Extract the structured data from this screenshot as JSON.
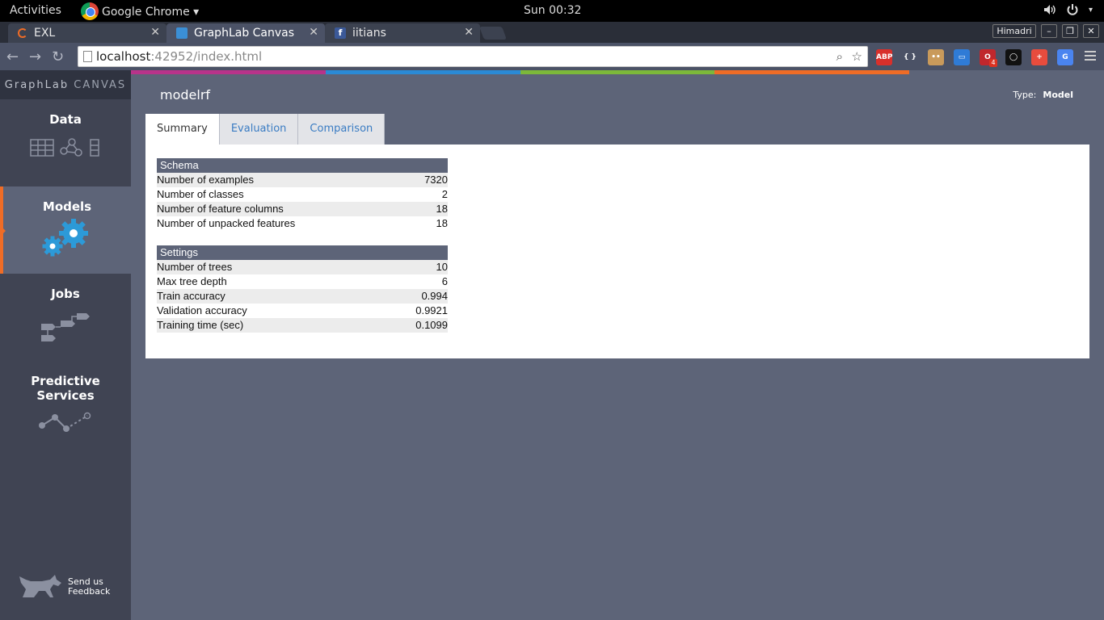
{
  "os": {
    "activities": "Activities",
    "app_name": "Google Chrome ▾",
    "clock": "Sun 00:32"
  },
  "browser": {
    "tabs": [
      {
        "title": "EXL"
      },
      {
        "title": "GraphLab Canvas"
      },
      {
        "title": "iitians"
      }
    ],
    "user": "Himadri",
    "url_host": "localhost",
    "url_path": ":42952/index.html",
    "extensions": [
      {
        "name": "adblock-plus-icon",
        "label": "ABP",
        "color": "#d9302b"
      },
      {
        "name": "json-formatter-icon",
        "label": "{ }",
        "color": "#4b5266"
      },
      {
        "name": "face-extension-icon",
        "label": "••",
        "color": "#c99a5b"
      },
      {
        "name": "pocket-extension-icon",
        "label": "▭",
        "color": "#2f7bd6"
      },
      {
        "name": "opera-extension-icon",
        "label": "O",
        "color": "#c0272d"
      },
      {
        "name": "ring-extension-icon",
        "label": "◯",
        "color": "#111111"
      },
      {
        "name": "medical-cross-icon",
        "label": "+",
        "color": "#e84c3d"
      },
      {
        "name": "google-translate-icon",
        "label": "G",
        "color": "#4a84f0"
      }
    ],
    "ext_badge": "4"
  },
  "canvas": {
    "brand_1": "GraphLab ",
    "brand_2": "CANVAS",
    "nav": [
      {
        "label": "Data",
        "icon": "table-icon"
      },
      {
        "label": "Models",
        "icon": "gears-icon"
      },
      {
        "label": "Jobs",
        "icon": "flow-icon"
      },
      {
        "label": "Predictive Services",
        "icon": "line-graph-icon"
      }
    ],
    "feedback_line1": "Send us",
    "feedback_line2": "Feedback",
    "accent_colors": [
      "#b8338a",
      "#2a8ad6",
      "#7cb83a",
      "#ef6c26"
    ],
    "nav_active_color": "#ef6c26"
  },
  "model": {
    "title": "modelrf",
    "type_label": "Type:",
    "type_value": "Model",
    "tabs": [
      "Summary",
      "Evaluation",
      "Comparison"
    ],
    "active_tab": "Summary",
    "schema": {
      "header": "Schema",
      "rows": [
        {
          "label": "Number of examples",
          "value": "7320"
        },
        {
          "label": "Number of classes",
          "value": "2"
        },
        {
          "label": "Number of feature columns",
          "value": "18"
        },
        {
          "label": "Number of unpacked features",
          "value": "18"
        }
      ]
    },
    "settings": {
      "header": "Settings",
      "rows": [
        {
          "label": "Number of trees",
          "value": "10"
        },
        {
          "label": "Max tree depth",
          "value": "6"
        },
        {
          "label": "Train accuracy",
          "value": "0.994"
        },
        {
          "label": "Validation accuracy",
          "value": "0.9921"
        },
        {
          "label": "Training time (sec)",
          "value": "0.1099"
        }
      ]
    }
  }
}
